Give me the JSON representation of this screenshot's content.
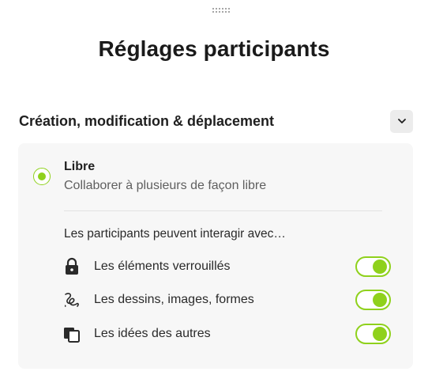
{
  "panel": {
    "title": "Réglages participants"
  },
  "section": {
    "title": "Création, modification & déplacement",
    "collapse_icon": "chevron-down-icon"
  },
  "mode": {
    "selected": true,
    "title": "Libre",
    "description": "Collaborer à plusieurs de façon libre"
  },
  "permissions": {
    "heading": "Les participants peuvent interagir avec…",
    "items": [
      {
        "label": "Les éléments verrouillés",
        "icon": "lock-icon",
        "enabled": true
      },
      {
        "label": "Les dessins, images, formes",
        "icon": "drawing-icon",
        "enabled": true
      },
      {
        "label": "Les idées des autres",
        "icon": "cards-icon",
        "enabled": true
      }
    ]
  },
  "colors": {
    "accent": "#8fd11c",
    "card_background": "#f7f7f7",
    "button_background": "#ececec"
  }
}
